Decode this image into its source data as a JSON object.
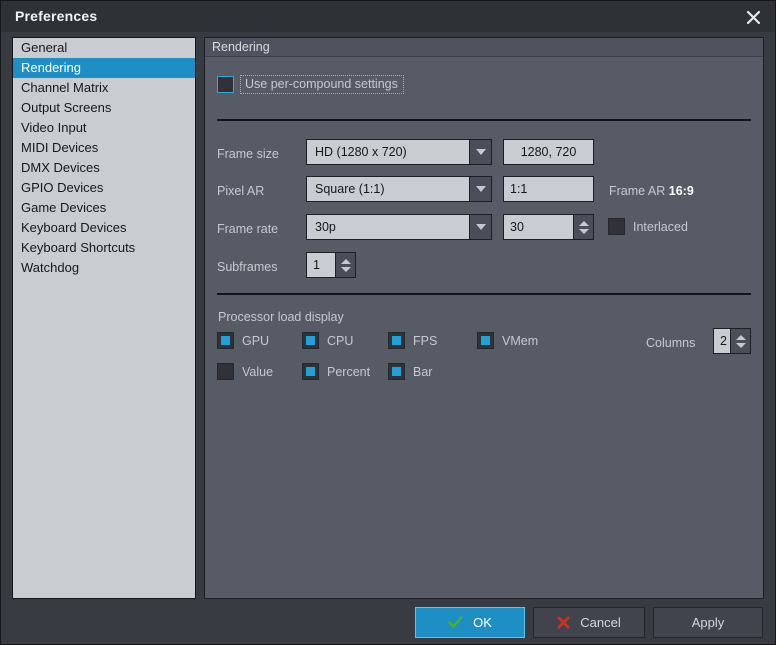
{
  "window": {
    "title": "Preferences",
    "close_icon": "close-icon"
  },
  "sidebar": {
    "items": [
      {
        "label": "General",
        "selected": false
      },
      {
        "label": "Rendering",
        "selected": true
      },
      {
        "label": "Channel Matrix",
        "selected": false
      },
      {
        "label": "Output Screens",
        "selected": false
      },
      {
        "label": "Video Input",
        "selected": false
      },
      {
        "label": "MIDI Devices",
        "selected": false
      },
      {
        "label": "DMX Devices",
        "selected": false
      },
      {
        "label": "GPIO Devices",
        "selected": false
      },
      {
        "label": "Game Devices",
        "selected": false
      },
      {
        "label": "Keyboard Devices",
        "selected": false
      },
      {
        "label": "Keyboard Shortcuts",
        "selected": false
      },
      {
        "label": "Watchdog",
        "selected": false
      }
    ]
  },
  "panel": {
    "header": "Rendering",
    "per_compound": {
      "label": "Use per-compound settings",
      "checked": false,
      "focused": true
    },
    "frame_size": {
      "label": "Frame size",
      "dropdown_value": "HD (1280 x 720)",
      "field_value": "1280, 720"
    },
    "pixel_ar": {
      "label": "Pixel AR",
      "dropdown_value": "Square (1:1)",
      "field_value": "1:1",
      "frame_ar_label": "Frame AR",
      "frame_ar_value": "16:9"
    },
    "frame_rate": {
      "label": "Frame rate",
      "dropdown_value": "30p",
      "spinner_value": "30",
      "interlaced_label": "Interlaced",
      "interlaced_checked": false
    },
    "subframes": {
      "label": "Subframes",
      "value": "1"
    },
    "processor_load": {
      "title": "Processor load display",
      "row1": [
        {
          "label": "GPU",
          "checked": true
        },
        {
          "label": "CPU",
          "checked": true
        },
        {
          "label": "FPS",
          "checked": true
        },
        {
          "label": "VMem",
          "checked": true
        }
      ],
      "row2": [
        {
          "label": "Value",
          "checked": false
        },
        {
          "label": "Percent",
          "checked": true
        },
        {
          "label": "Bar",
          "checked": true
        }
      ],
      "columns_label": "Columns",
      "columns_value": "2"
    }
  },
  "footer": {
    "ok": {
      "label": "OK",
      "icon": "checkmark-icon"
    },
    "cancel": {
      "label": "Cancel",
      "icon": "cross-icon"
    },
    "apply": {
      "label": "Apply"
    }
  },
  "colors": {
    "accent": "#1e8fc4",
    "checkbox_fill": "#21a1da",
    "ok_check": "#4caf2a",
    "cancel_cross": "#d03025",
    "titlebar": "#2e3136",
    "panel": "#575b66",
    "list_bg": "#c9cdd1"
  }
}
